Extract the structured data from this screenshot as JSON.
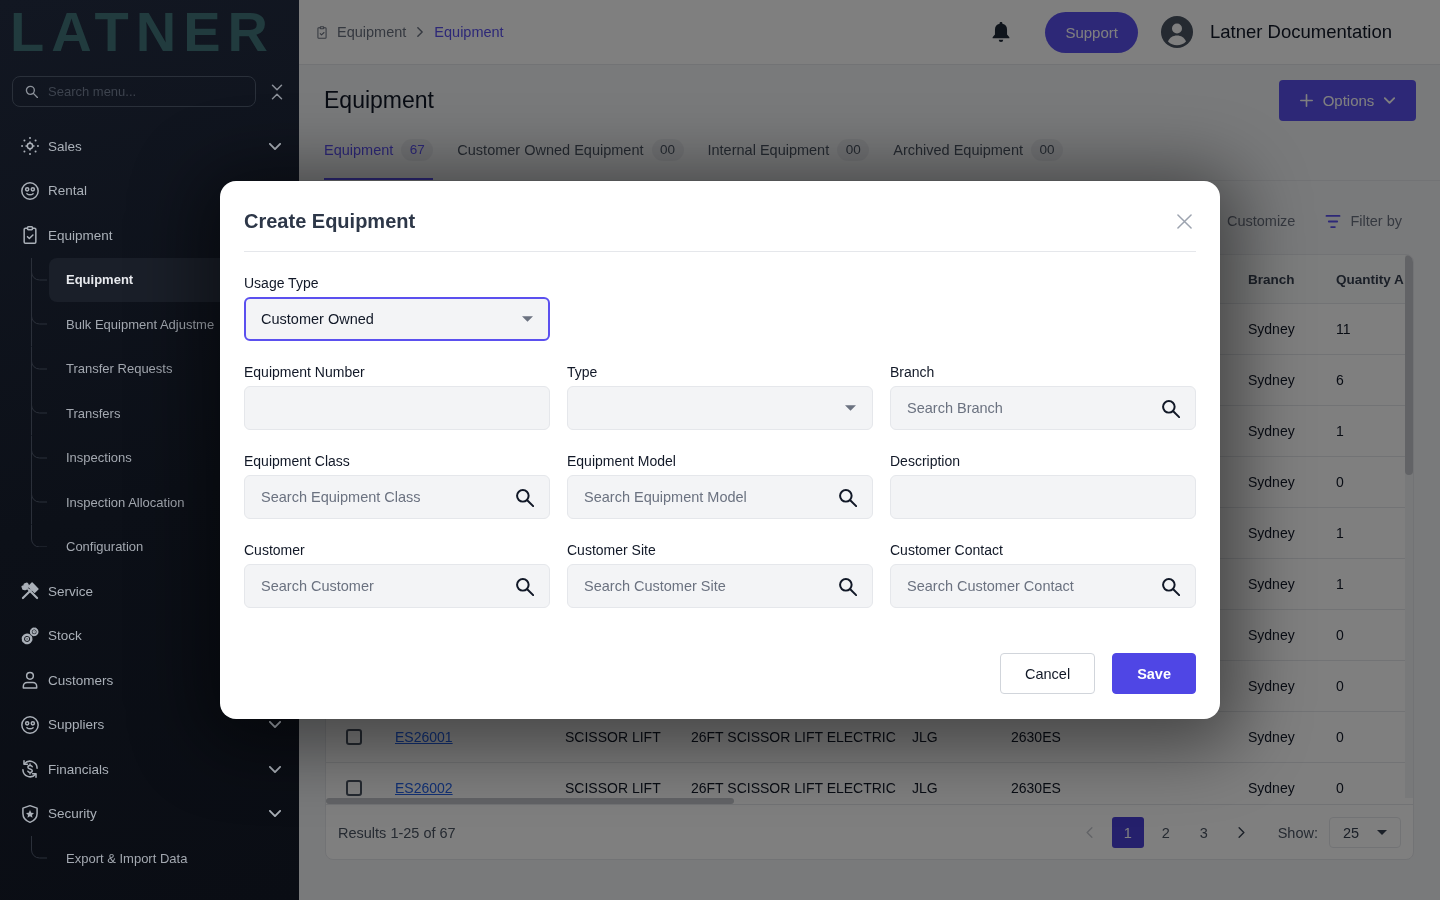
{
  "sidebar": {
    "logo": "LATNER",
    "search": {
      "placeholder": "Search menu..."
    },
    "items": [
      {
        "label": "Sales",
        "expandable": true
      },
      {
        "label": "Rental"
      },
      {
        "label": "Equipment",
        "children": [
          {
            "label": "Equipment",
            "selected": true
          },
          {
            "label": "Bulk Equipment Adjustme",
            "selected": false
          },
          {
            "label": "Transfer Requests",
            "selected": false
          },
          {
            "label": "Transfers",
            "selected": false
          },
          {
            "label": "Inspections",
            "selected": false
          },
          {
            "label": "Inspection Allocation",
            "selected": false
          },
          {
            "label": "Configuration",
            "selected": false
          }
        ]
      },
      {
        "label": "Service"
      },
      {
        "label": "Stock"
      },
      {
        "label": "Customers"
      },
      {
        "label": "Suppliers",
        "expandable": true
      },
      {
        "label": "Financials",
        "expandable": true
      },
      {
        "label": "Security",
        "expandable": true,
        "children": [
          {
            "label": "Export & Import Data",
            "selected": false
          }
        ]
      }
    ]
  },
  "header": {
    "breadcrumb": [
      {
        "label": "Equipment",
        "current": false
      },
      {
        "label": "Equipment",
        "current": true
      }
    ],
    "support_button": "Support",
    "user_name": "Latner Documentation"
  },
  "page": {
    "title": "Equipment",
    "options_button": "Options"
  },
  "tabs": [
    {
      "label": "Equipment",
      "count": "67",
      "selected": true
    },
    {
      "label": "Customer Owned Equipment",
      "count": "00",
      "selected": false
    },
    {
      "label": "Internal Equipment",
      "count": "00",
      "selected": false
    },
    {
      "label": "Archived Equipment",
      "count": "00",
      "selected": false
    }
  ],
  "toolbar": {
    "customize": "Customize",
    "filter": "Filter by"
  },
  "table": {
    "columns": [
      "Branch",
      "Quantity A"
    ],
    "rows": [
      {
        "branch": "Sydney",
        "quantity_a": "11"
      },
      {
        "branch": "Sydney",
        "quantity_a": "6"
      },
      {
        "branch": "Sydney",
        "quantity_a": "1"
      },
      {
        "branch": "Sydney",
        "quantity_a": "0"
      },
      {
        "branch": "Sydney",
        "quantity_a": "1"
      },
      {
        "branch": "Sydney",
        "quantity_a": "1"
      },
      {
        "branch": "Sydney",
        "quantity_a": "0"
      },
      {
        "branch": "Sydney",
        "quantity_a": "0"
      },
      {
        "checked": false,
        "column_2": "ES26001",
        "column_3": "SCISSOR LIFT",
        "column_4": "26FT SCISSOR LIFT ELECTRIC",
        "column_5": "JLG",
        "column_6": "2630ES",
        "branch": "Sydney",
        "quantity_a": "0"
      },
      {
        "checked": false,
        "column_2": "ES26002",
        "column_3": "SCISSOR LIFT",
        "column_4": "26FT SCISSOR LIFT ELECTRIC",
        "column_5": "JLG",
        "column_6": "2630ES",
        "branch": "Sydney",
        "quantity_a": "0"
      }
    ]
  },
  "pagination": {
    "summary": "Results 1-25 of 67",
    "previous_disabled": true,
    "pages": [
      {
        "label": "1",
        "selected": true
      },
      {
        "label": "2",
        "selected": false
      },
      {
        "label": "3",
        "selected": false
      }
    ],
    "next_disabled": false,
    "show_label": "Show:",
    "page_size": "25"
  },
  "modal": {
    "title": "Create Equipment",
    "usage_type": {
      "label": "Usage Type",
      "value": "Customer Owned",
      "focused": true
    },
    "fields": [
      {
        "kind": "text",
        "label": "Equipment Number"
      },
      {
        "kind": "select",
        "label": "Type"
      },
      {
        "kind": "search",
        "label": "Branch",
        "placeholder": "Search Branch"
      },
      {
        "kind": "search",
        "label": "Equipment Class",
        "placeholder": "Search Equipment Class"
      },
      {
        "kind": "search",
        "label": "Equipment Model",
        "placeholder": "Search Equipment Model"
      },
      {
        "kind": "text",
        "label": "Description"
      },
      {
        "kind": "search",
        "label": "Customer",
        "placeholder": "Search Customer"
      },
      {
        "kind": "search",
        "label": "Customer Site",
        "placeholder": "Search Customer Site"
      },
      {
        "kind": "search",
        "label": "Customer Contact",
        "placeholder": "Search Customer Contact"
      }
    ],
    "buttons": [
      {
        "label": "Cancel",
        "kind": "secondary"
      },
      {
        "label": "Save",
        "kind": "primary"
      }
    ]
  }
}
